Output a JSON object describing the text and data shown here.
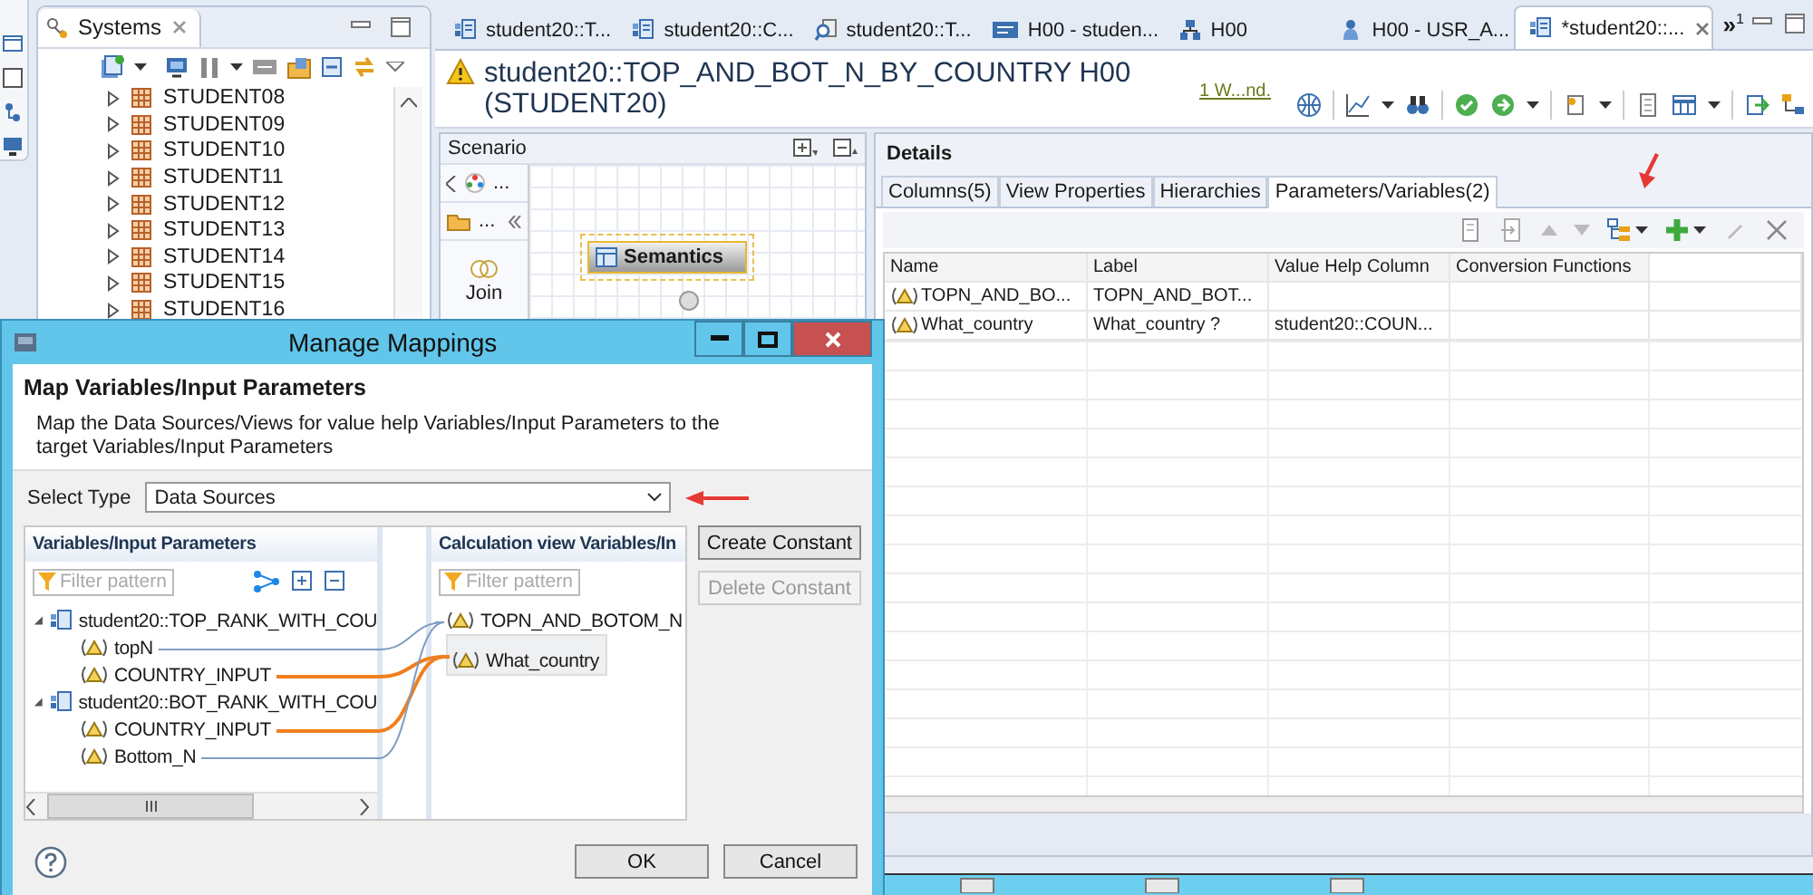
{
  "systems": {
    "title": "Systems",
    "items": [
      "STUDENT08",
      "STUDENT09",
      "STUDENT10",
      "STUDENT11",
      "STUDENT12",
      "STUDENT13",
      "STUDENT14",
      "STUDENT15",
      "STUDENT16"
    ]
  },
  "editor_tabs": [
    {
      "label": "student20::T...",
      "kind": "view",
      "selected": false
    },
    {
      "label": "student20::C...",
      "kind": "view",
      "selected": false
    },
    {
      "label": "student20::T...",
      "kind": "query",
      "selected": false
    },
    {
      "label": "H00 - studen...",
      "kind": "sql",
      "selected": false
    },
    {
      "label": "H00",
      "kind": "system",
      "selected": false
    },
    {
      "label": "H00 - USR_A...",
      "kind": "user",
      "selected": false
    },
    {
      "label": "*student20::...",
      "kind": "view",
      "selected": true
    }
  ],
  "overflow_tabs": {
    "label": "»",
    "count": "1"
  },
  "editor": {
    "title": "student20::TOP_AND_BOT_N_BY_COUNTRY H00",
    "subtitle": "(STUDENT20)",
    "warning_link": "1 W...nd."
  },
  "scenario": {
    "title": "Scenario",
    "nav_label": "...",
    "folder_label": "...",
    "palette": [
      "Join"
    ],
    "node": "Semantics"
  },
  "details": {
    "title": "Details",
    "tabs": [
      {
        "label": "Columns(5)",
        "selected": false
      },
      {
        "label": "View Properties",
        "selected": false
      },
      {
        "label": "Hierarchies",
        "selected": false
      },
      {
        "label": "Parameters/Variables(2)",
        "selected": true
      }
    ],
    "columns": [
      "Name",
      "Label",
      "Value Help Column",
      "Conversion Functions"
    ],
    "rows": [
      {
        "name": "TOPN_AND_BO...",
        "label": "TOPN_AND_BOT..."
      },
      {
        "name": "What_country",
        "label": "What_country ?",
        "value_help": "student20::COUN..."
      }
    ]
  },
  "dialog": {
    "title": "Manage Mappings",
    "heading": "Map Variables/Input Parameters",
    "description": "Map the Data Sources/Views for value help  Variables/Input Parameters to the target Variables/Input Parameters",
    "select_label": "Select Type",
    "select_value": "Data Sources",
    "source": {
      "title": "Variables/Input Parameters",
      "filter_placeholder": "Filter pattern",
      "groups": [
        {
          "label": "student20::TOP_RANK_WITH_COU",
          "expanded": true,
          "children": [
            {
              "label": "topN",
              "highlighted": false
            },
            {
              "label": "COUNTRY_INPUT",
              "highlighted": true
            }
          ]
        },
        {
          "label": "student20::BOT_RANK_WITH_COU",
          "expanded": true,
          "children": [
            {
              "label": "COUNTRY_INPUT",
              "highlighted": true
            },
            {
              "label": "Bottom_N",
              "highlighted": false
            }
          ]
        }
      ]
    },
    "target": {
      "title": "Calculation view Variables/In",
      "filter_placeholder": "Filter pattern",
      "items": [
        {
          "label": "TOPN_AND_BOTOM_N",
          "selected": false
        },
        {
          "label": "What_country",
          "selected": true
        }
      ]
    },
    "side_buttons": [
      {
        "label": "Create Constant",
        "disabled": false
      },
      {
        "label": "Delete Constant",
        "disabled": true
      }
    ],
    "buttons": [
      "OK",
      "Cancel"
    ]
  }
}
